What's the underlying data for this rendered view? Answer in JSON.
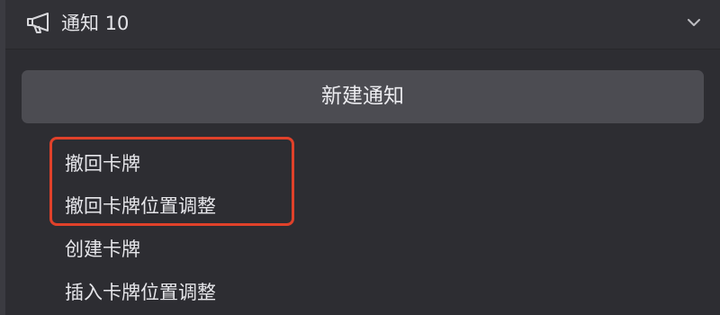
{
  "header": {
    "title": "通知 10",
    "icon": "megaphone-icon",
    "chevron": "chevron-down-icon"
  },
  "new_button": {
    "label": "新建通知"
  },
  "items": [
    {
      "label": "撤回卡牌"
    },
    {
      "label": "撤回卡牌位置调整"
    },
    {
      "label": "创建卡牌"
    },
    {
      "label": "插入卡牌位置调整"
    }
  ],
  "highlight": {
    "color": "#e0412a"
  },
  "colors": {
    "background": "#2d2d32",
    "button": "#4c4c52",
    "text": "#e6e6ea"
  }
}
